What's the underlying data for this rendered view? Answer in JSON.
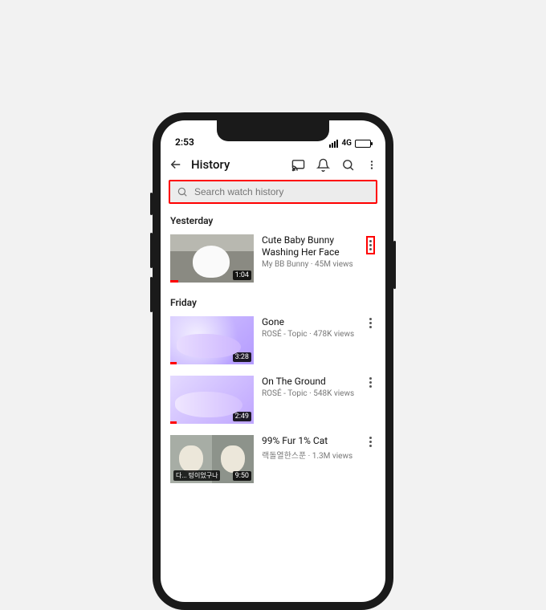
{
  "status": {
    "time": "2:53",
    "network": "4G"
  },
  "header": {
    "title": "History"
  },
  "search": {
    "placeholder": "Search watch history"
  },
  "sections": [
    {
      "label": "Yesterday",
      "items": [
        {
          "title": "Cute Baby Bunny Washing Her Face",
          "channel": "My BB Bunny",
          "views": "45M views",
          "duration": "1:04",
          "progress_pct": 10
        }
      ]
    },
    {
      "label": "Friday",
      "items": [
        {
          "title": "Gone",
          "channel": "ROSÉ - Topic",
          "views": "478K views",
          "duration": "3:28",
          "progress_pct": 8
        },
        {
          "title": "On The Ground",
          "channel": "ROSÉ - Topic",
          "views": "548K views",
          "duration": "2:49",
          "progress_pct": 8
        },
        {
          "title": "99% Fur 1% Cat",
          "channel": "랙돌열한스푼",
          "views": "1.3M views",
          "duration": "9:50",
          "caption": "다... 텅이었구나"
        }
      ]
    }
  ]
}
